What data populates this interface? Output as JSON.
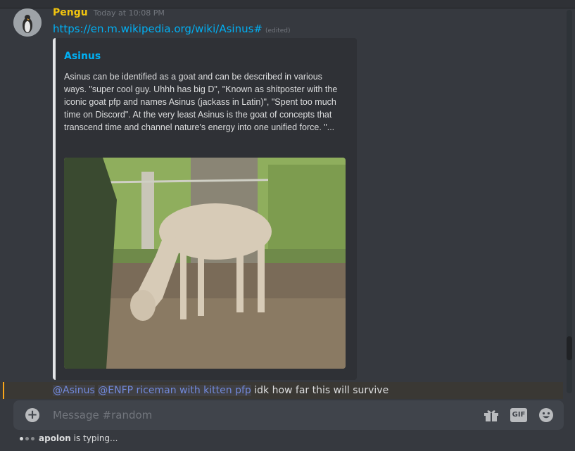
{
  "message": {
    "username": "Pengu",
    "timestamp": "Today at 10:08 PM",
    "link": "https://en.m.wikipedia.org/wiki/Asinus#",
    "edited": "(edited)"
  },
  "embed": {
    "title": "Asinus",
    "description": "Asinus can be identified as a goat and can be described in various ways. \"super cool guy. Uhhh has big D\", \"Known as shitposter with the iconic goat pfp and names Asinus (jackass in Latin)\", \"Spent too much time on Discord\". At the very least Asinus is the goat of concepts that transcend time and channel nature's energy into one unified force. \"..."
  },
  "reply": {
    "mention1": "@Asinus",
    "mention2": "@ENFP riceman with kitten pfp",
    "text": " idk how far this will survive"
  },
  "composer": {
    "placeholder": "Message #random",
    "plus": "+",
    "gif": "GIF"
  },
  "typing": {
    "user": "apolon",
    "suffix": " is typing..."
  },
  "colors": {
    "background": "#36393f",
    "username": "#f1c40f",
    "link": "#00b0f4",
    "mention": "#7289da",
    "highlight_bar": "#faa61a"
  },
  "icons": [
    "plus-icon",
    "gift-icon",
    "gif-icon",
    "emoji-icon"
  ]
}
